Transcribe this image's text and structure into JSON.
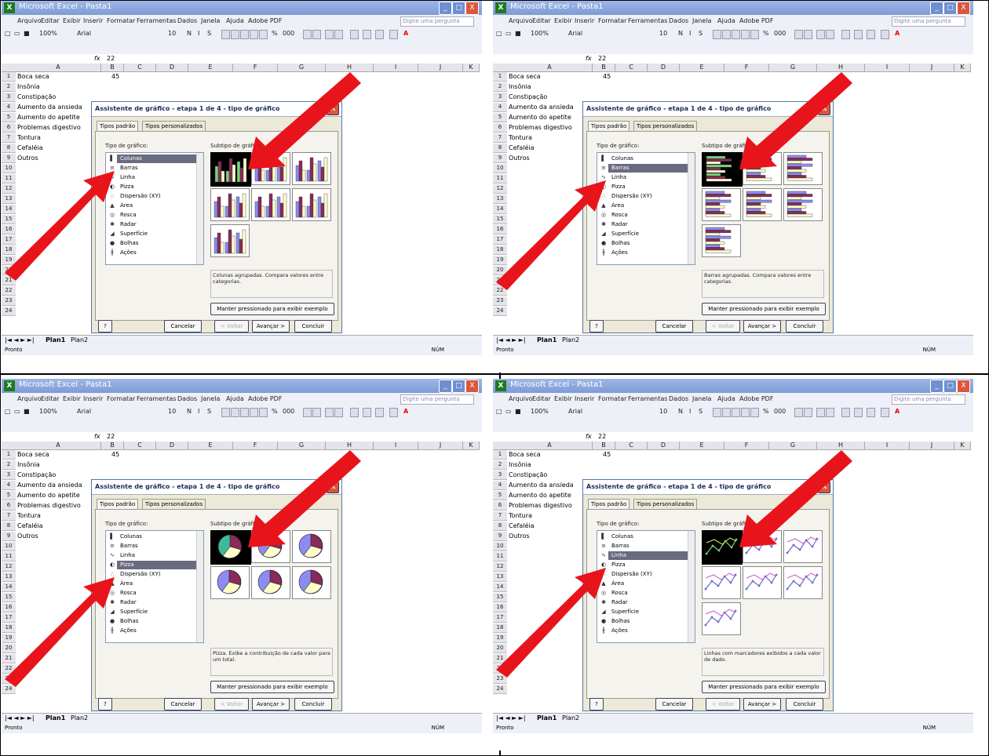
{
  "window": {
    "title": "Microsoft Excel - Pasta1",
    "minimize": "_",
    "maximize": "□",
    "close": "X"
  },
  "menu": [
    "Arquivo",
    "Editar",
    "Exibir",
    "Inserir",
    "Formatar",
    "Ferramentas",
    "Dados",
    "Janela",
    "Ajuda",
    "Adobe PDF"
  ],
  "help_box": "Digite uma pergunta",
  "toolbar": {
    "zoom": "100%",
    "font": "Arial",
    "size": "10",
    "bold": "N",
    "italic": "I",
    "underline": "S",
    "percent": "%",
    "thousands": "000"
  },
  "formula": {
    "fx": "fx",
    "value": "22"
  },
  "columns": [
    "A",
    "B",
    "C",
    "D",
    "E",
    "F",
    "G",
    "H",
    "I",
    "J",
    "K"
  ],
  "rows": [
    {
      "n": "1",
      "label": "Boca seca",
      "val": "45"
    },
    {
      "n": "2",
      "label": "Insônia",
      "val": ""
    },
    {
      "n": "3",
      "label": "Constipação",
      "val": ""
    },
    {
      "n": "4",
      "label": "Aumento da ansieda",
      "val": ""
    },
    {
      "n": "5",
      "label": "Aumento do apetite",
      "val": ""
    },
    {
      "n": "6",
      "label": "Problemas digestivo",
      "val": ""
    },
    {
      "n": "7",
      "label": "Tontura",
      "val": ""
    },
    {
      "n": "8",
      "label": "Cefaléia",
      "val": ""
    },
    {
      "n": "9",
      "label": "Outros",
      "val": ""
    },
    {
      "n": "10",
      "label": "",
      "val": ""
    },
    {
      "n": "11",
      "label": "",
      "val": ""
    },
    {
      "n": "12",
      "label": "",
      "val": ""
    },
    {
      "n": "13",
      "label": "",
      "val": ""
    },
    {
      "n": "14",
      "label": "",
      "val": ""
    },
    {
      "n": "15",
      "label": "",
      "val": ""
    },
    {
      "n": "16",
      "label": "",
      "val": ""
    },
    {
      "n": "17",
      "label": "",
      "val": ""
    },
    {
      "n": "18",
      "label": "",
      "val": ""
    },
    {
      "n": "19",
      "label": "",
      "val": ""
    },
    {
      "n": "20",
      "label": "",
      "val": ""
    },
    {
      "n": "21",
      "label": "",
      "val": ""
    },
    {
      "n": "22",
      "label": "",
      "val": ""
    },
    {
      "n": "23",
      "label": "",
      "val": ""
    },
    {
      "n": "24",
      "label": "",
      "val": ""
    }
  ],
  "sheet_tabs": {
    "nav": "|◄ ◄ ► ►|",
    "tab1": "Plan1",
    "tab2": "Plan2"
  },
  "status": {
    "left": "Pronto",
    "right": "NÚM"
  },
  "dialog": {
    "title": "Assistente de gráfico - etapa 1 de 4 - tipo de gráfico",
    "help": "?",
    "close": "X",
    "tab_standard": "Tipos padrão",
    "tab_custom": "Tipos personalizados",
    "type_label": "Tipo de gráfico:",
    "subtype_label": "Subtipo de gráfico:",
    "types": [
      "Colunas",
      "Barras",
      "Linha",
      "Pizza",
      "Dispersão (XY)",
      "Área",
      "Rosca",
      "Radar",
      "Superfície",
      "Bolhas",
      "Ações"
    ],
    "type_icons": [
      "▌",
      "≡",
      "∿",
      "◐",
      "∴",
      "▲",
      "◎",
      "✱",
      "◢",
      "●",
      "╫"
    ],
    "hold_button": "Manter pressionado para exibir exemplo",
    "cancel": "Cancelar",
    "back": "< Voltar",
    "next": "Avançar >",
    "finish": "Concluir",
    "help_icon": "?"
  },
  "quadrants": [
    {
      "selected": 0,
      "description": "Colunas agrupadas. Compara valores entre categorias.",
      "chart_kind": "columns"
    },
    {
      "selected": 1,
      "description": "Barras agrupadas. Compara valores entre categorias.",
      "chart_kind": "bars"
    },
    {
      "selected": 3,
      "description": "Pizza. Exibe a contribuição de cada valor para um total.",
      "chart_kind": "pie"
    },
    {
      "selected": 2,
      "description": "Linhas com marcadores exibidos a cada valor de dado.",
      "chart_kind": "line"
    }
  ],
  "colors": {
    "arrow": "#e8141c",
    "title_bar": "#7d9bd6",
    "dialog_bg": "#ece9d8",
    "selected_item": "#6a6a80"
  }
}
